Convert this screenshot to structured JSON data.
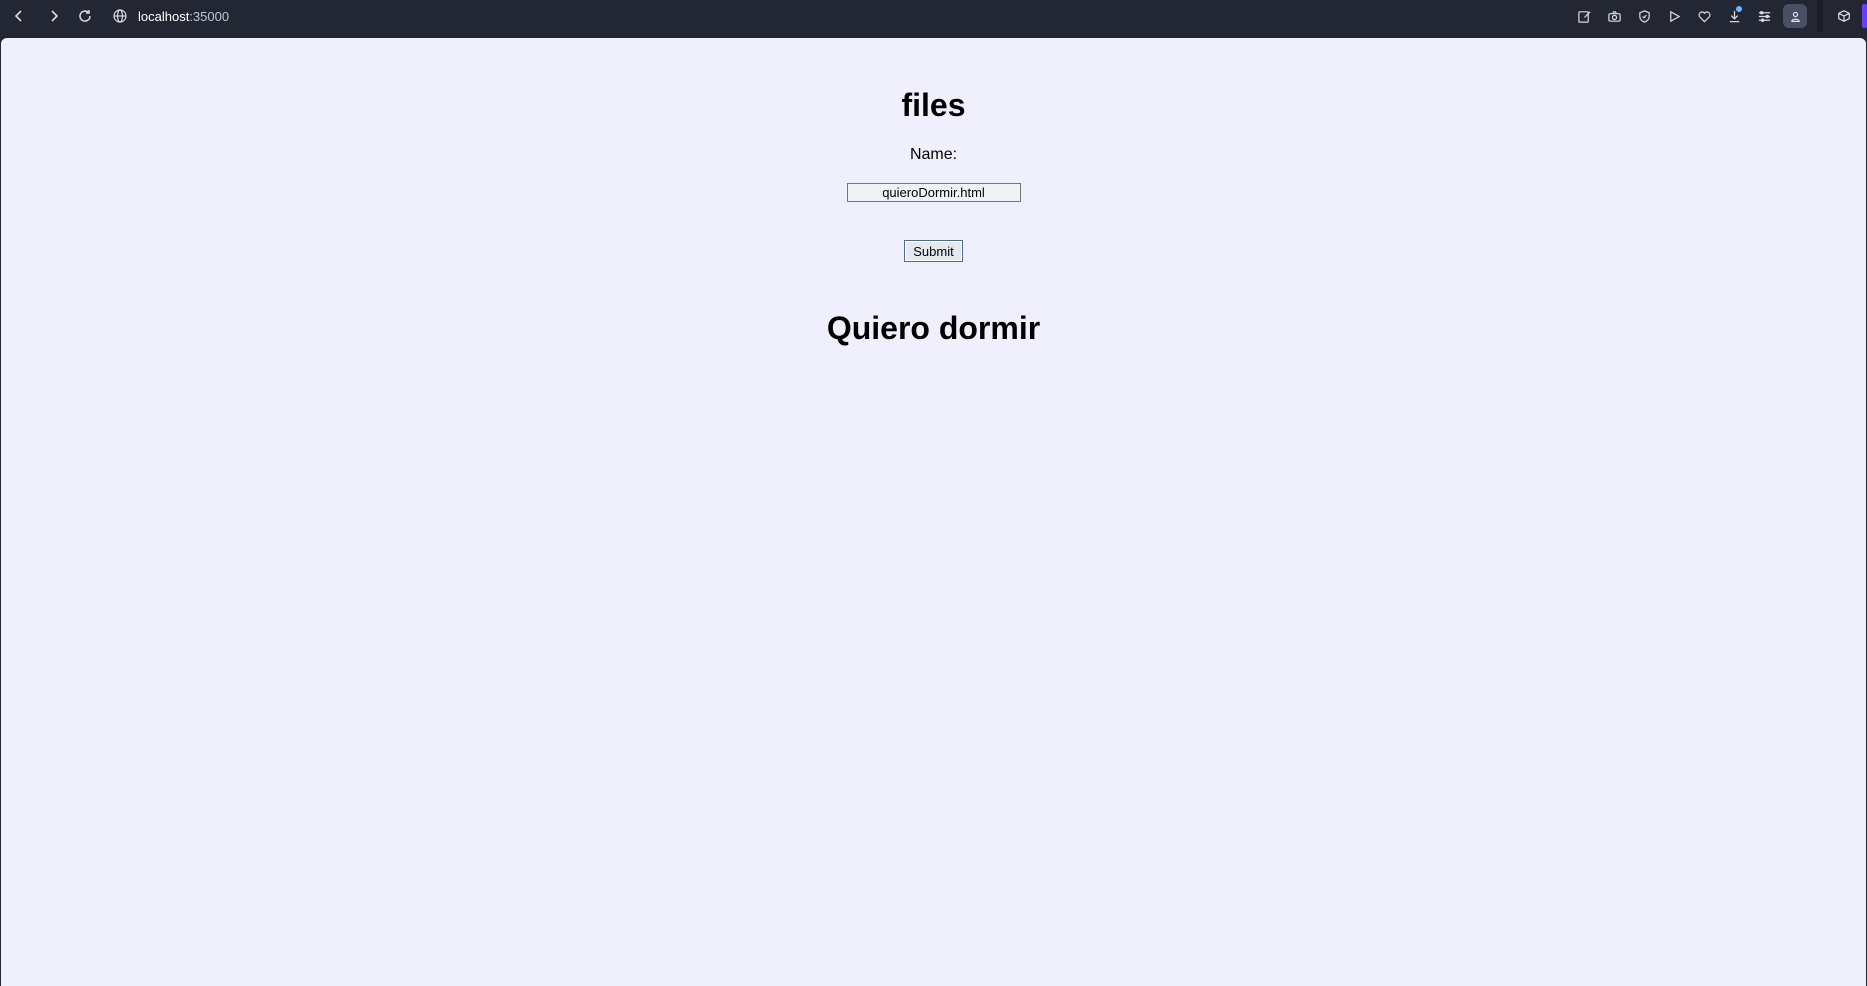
{
  "browser": {
    "address_host": "localhost",
    "address_port": ":35000",
    "nav_icons": [
      "back-icon",
      "forward-icon",
      "reload-icon",
      "globe-icon"
    ],
    "toolbar_icons": [
      "edit-icon",
      "camera-icon",
      "shield-icon",
      "send-icon",
      "heart-icon",
      "download-icon",
      "menu-icon",
      "profile-icon",
      "extensions-icon"
    ],
    "accent_color": "#6b3cff"
  },
  "page": {
    "title": "files",
    "name_label": "Name:",
    "name_input_value": "quieroDormir.html",
    "submit_label": "Submit",
    "output_heading": "Quiero dormir",
    "background_color": "#f0f0fd"
  }
}
